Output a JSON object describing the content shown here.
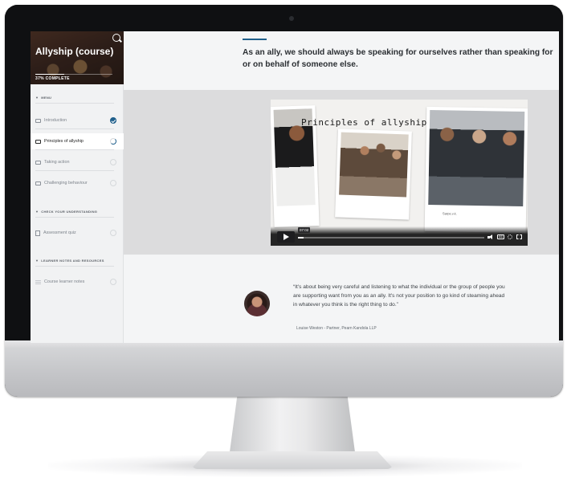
{
  "sidebar": {
    "course_title": "Allyship (course)",
    "progress_percent": 37,
    "progress_label": "37% COMPLETE",
    "sections": [
      {
        "title": "MENU",
        "items": [
          {
            "label": "Introduction",
            "status": "complete",
            "active": false
          },
          {
            "label": "Principles of allyship",
            "status": "in-progress",
            "active": true
          },
          {
            "label": "Taking action",
            "status": "not-started",
            "active": false
          },
          {
            "label": "Challenging behaviour",
            "status": "not-started",
            "active": false
          }
        ]
      },
      {
        "title": "CHECK YOUR UNDERSTANDING",
        "items": [
          {
            "label": "Assessment quiz",
            "status": "not-started",
            "active": false
          }
        ]
      },
      {
        "title": "LEARNER NOTES AND RESOURCES",
        "items": [
          {
            "label": "Course learner notes",
            "status": "not-started",
            "active": false
          }
        ]
      }
    ]
  },
  "main": {
    "lead_text": "As an ally, we should always be speaking for ourselves rather than speaking for or on behalf of someone else.",
    "video": {
      "title": "Principles of allyship",
      "duration": "07:02",
      "played_fraction": 0.03,
      "photo_caption": "Sarpe.v.k."
    },
    "testimonial": {
      "quote": "“It's about being very careful and listening to what the individual or the group of people you are supporting want from you as an ally. It's not your position to go kind of steaming ahead in whatever you think is the right thing to do.”",
      "attribution": "Louise Weston - Partner, Pearn Kandola LLP"
    }
  },
  "colors": {
    "accent": "#1f5f8b",
    "screen_bg": "#f4f5f6",
    "video_band": "#dcdcdd"
  }
}
